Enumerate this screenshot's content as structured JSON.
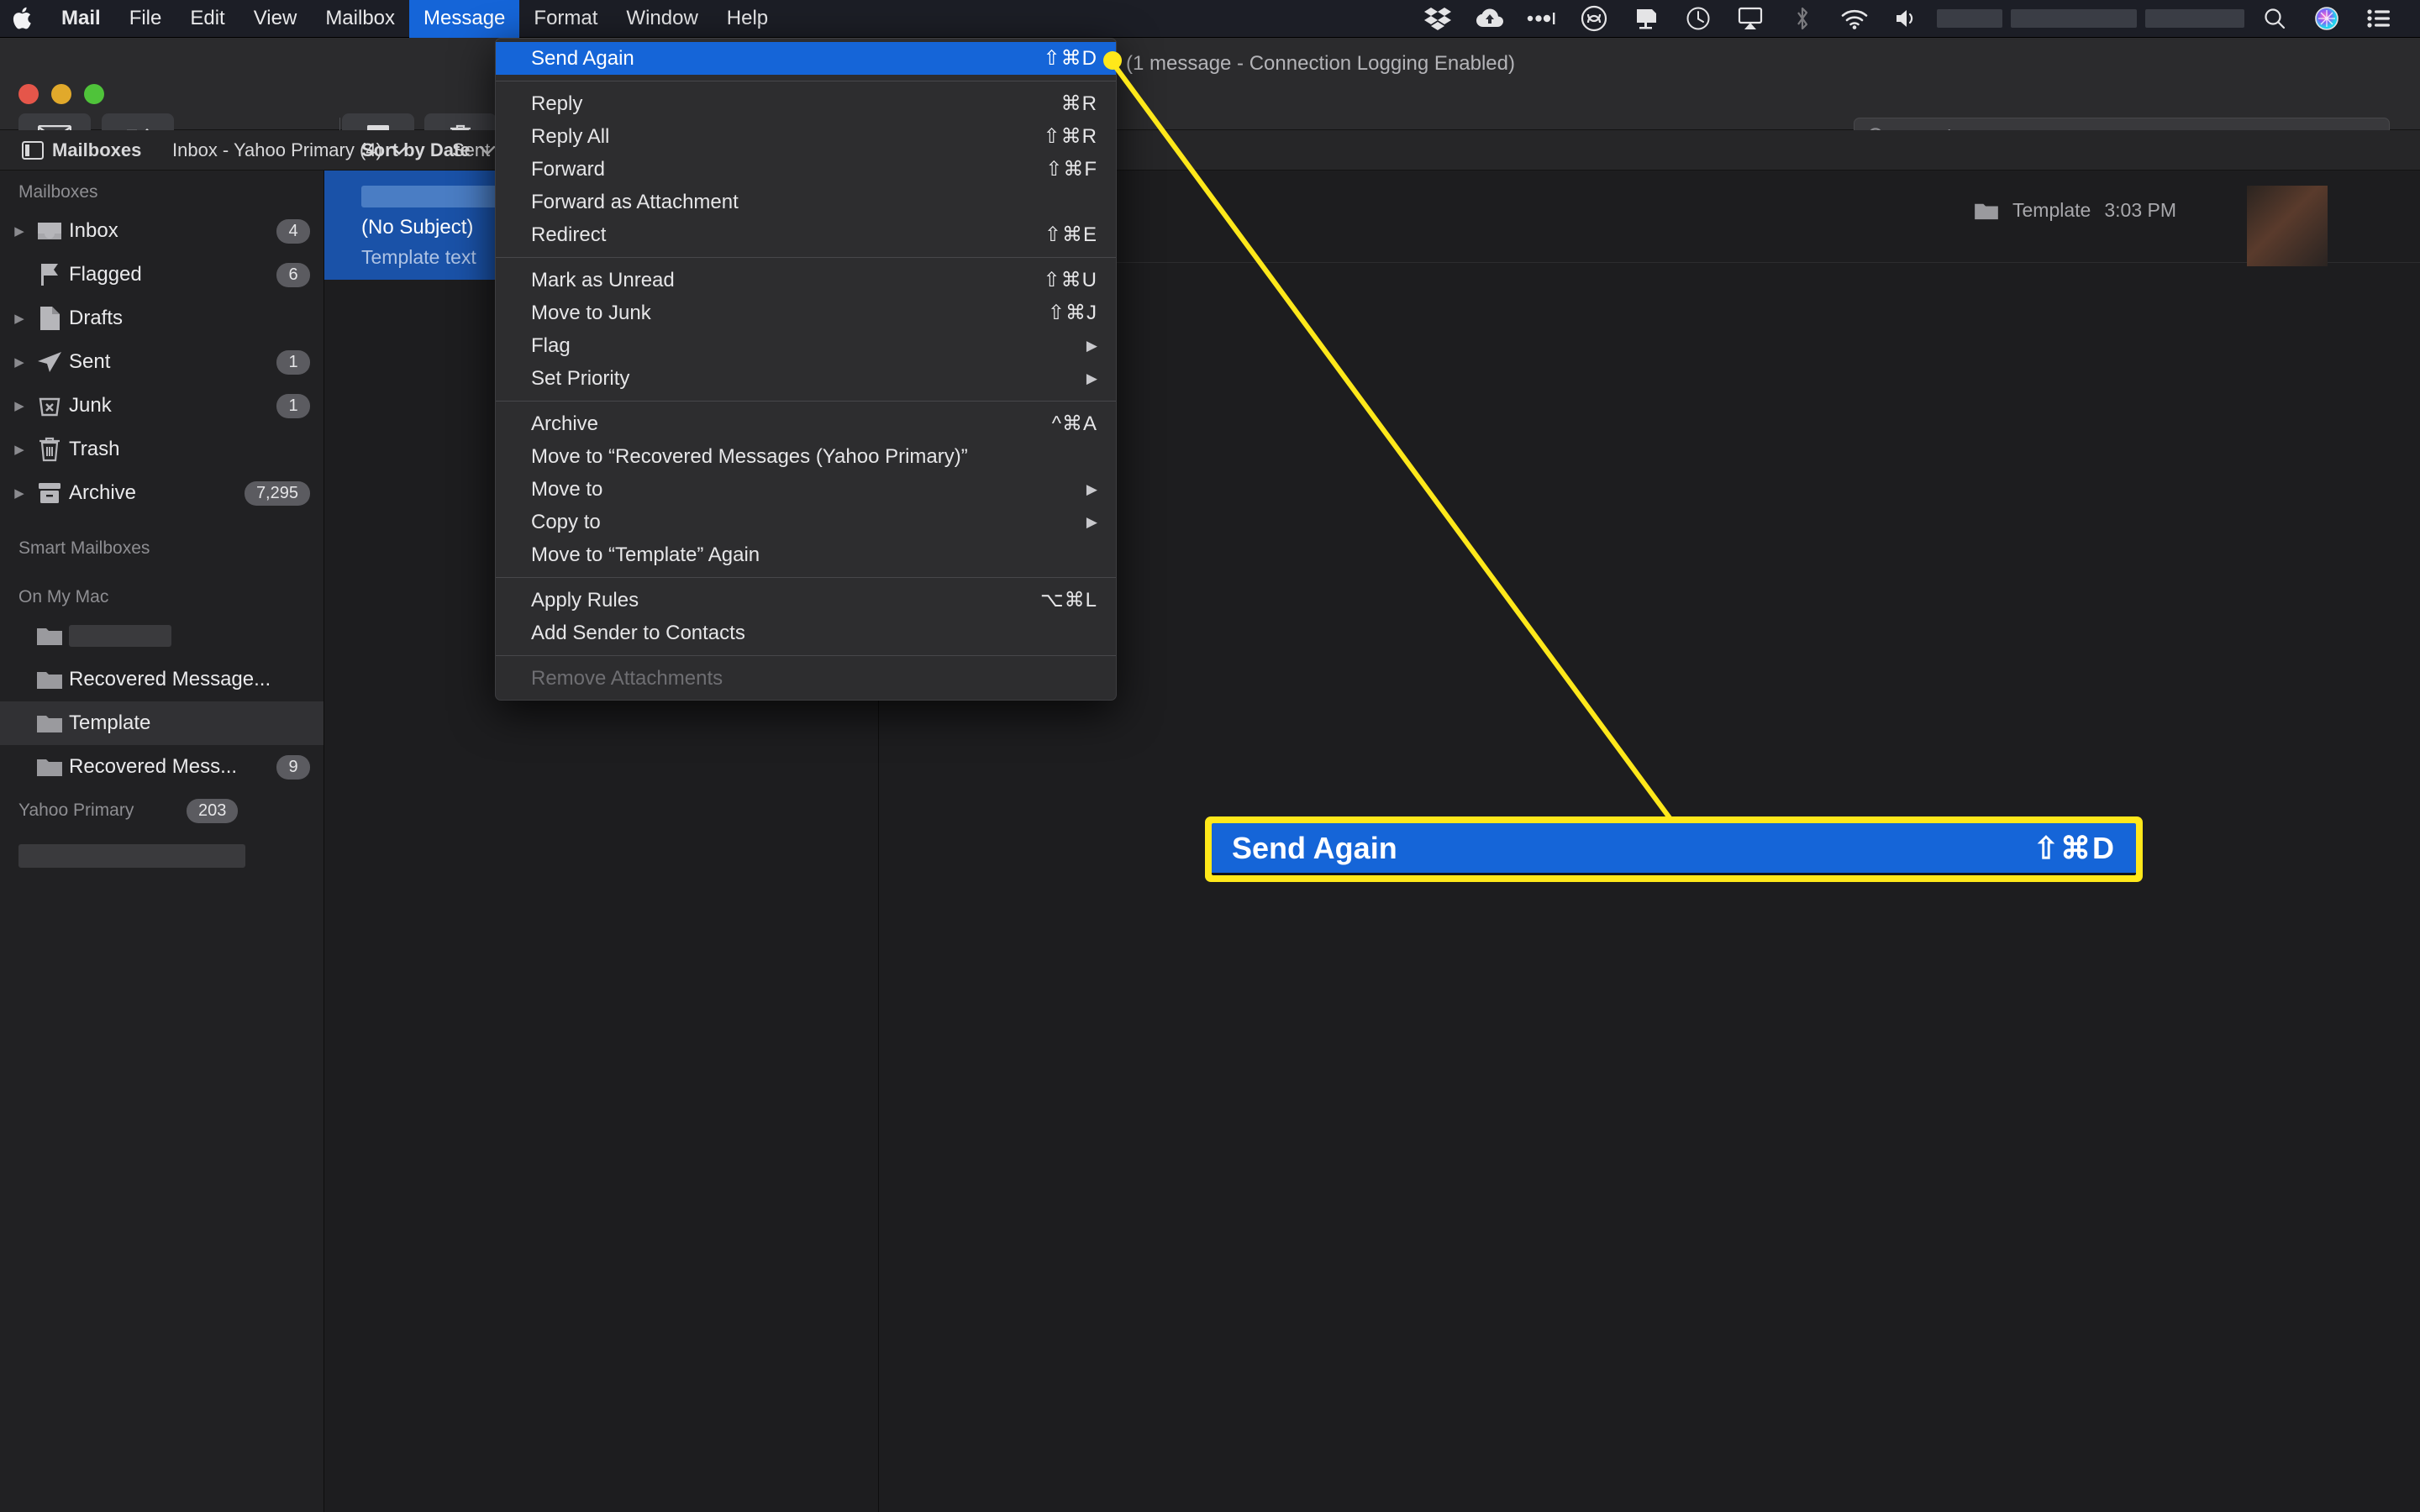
{
  "menubar": {
    "apple_icon": "apple-logo-icon",
    "items": [
      {
        "label": "Mail",
        "bold": true,
        "active": false
      },
      {
        "label": "File",
        "bold": false,
        "active": false
      },
      {
        "label": "Edit",
        "bold": false,
        "active": false
      },
      {
        "label": "View",
        "bold": false,
        "active": false
      },
      {
        "label": "Mailbox",
        "bold": false,
        "active": false
      },
      {
        "label": "Message",
        "bold": false,
        "active": true
      },
      {
        "label": "Format",
        "bold": false,
        "active": false
      },
      {
        "label": "Window",
        "bold": false,
        "active": false
      },
      {
        "label": "Help",
        "bold": false,
        "active": false
      }
    ],
    "status_icons": [
      "dropbox-icon",
      "cloud-upload-icon",
      "dots-icon",
      "creative-cloud-icon",
      "display-icon",
      "time-machine-icon",
      "airplay-icon",
      "bluetooth-icon",
      "wifi-icon",
      "volume-icon"
    ],
    "right_icons": [
      "spotlight-search-icon",
      "siri-icon",
      "control-center-icon"
    ]
  },
  "window": {
    "title_status": "(1 message - Connection Logging Enabled)",
    "toolbar": {
      "mail_button": "mail-icon",
      "compose_button": "compose-icon",
      "archive_button": "archive-icon",
      "delete_button": "trash-icon"
    },
    "search": {
      "placeholder": "Search",
      "value": ""
    },
    "subbar": {
      "mailboxes_label": "Mailboxes",
      "inbox_label": "Inbox - Yahoo Primary (4)",
      "sent_label": "Sent",
      "sort_label": "Sort by Date"
    }
  },
  "sidebar": {
    "section_mailboxes": "Mailboxes",
    "section_smart": "Smart Mailboxes",
    "section_onmymac": "On My Mac",
    "mailboxes": [
      {
        "label": "Inbox",
        "icon": "inbox-icon",
        "badge": "4",
        "disclosure": true
      },
      {
        "label": "Flagged",
        "icon": "flag-icon",
        "badge": "6",
        "disclosure": false
      },
      {
        "label": "Drafts",
        "icon": "drafts-icon",
        "badge": "",
        "disclosure": true
      },
      {
        "label": "Sent",
        "icon": "sent-icon",
        "badge": "1",
        "disclosure": true
      },
      {
        "label": "Junk",
        "icon": "junk-icon",
        "badge": "1",
        "disclosure": true
      },
      {
        "label": "Trash",
        "icon": "trash-icon",
        "badge": "",
        "disclosure": true
      },
      {
        "label": "Archive",
        "icon": "archive-icon",
        "badge": "7,295",
        "disclosure": true
      }
    ],
    "local_folders": [
      {
        "label": "",
        "icon": "folder-icon",
        "badge": "",
        "redacted": true,
        "selected": false
      },
      {
        "label": "Recovered Message...",
        "icon": "folder-icon",
        "badge": "",
        "redacted": false,
        "selected": false
      },
      {
        "label": "Template",
        "icon": "folder-icon",
        "badge": "",
        "redacted": false,
        "selected": true
      },
      {
        "label": "Recovered Mess...",
        "icon": "folder-icon",
        "badge": "9",
        "redacted": false,
        "selected": false
      }
    ],
    "account": {
      "label": "Yahoo Primary",
      "badge": "203"
    }
  },
  "message_list": {
    "sort_label": "Sort by Date",
    "items": [
      {
        "sender_redacted": true,
        "subject": "(No Subject)",
        "preview": "Template text",
        "selected": true
      }
    ]
  },
  "reading_pane": {
    "folder": "Template",
    "time": "3:03 PM"
  },
  "menu": {
    "title": "Message",
    "groups": [
      [
        {
          "label": "Send Again",
          "shortcut": "⇧⌘D",
          "highlighted": true,
          "submenu": false,
          "disabled": false
        }
      ],
      [
        {
          "label": "Reply",
          "shortcut": "⌘R",
          "highlighted": false,
          "submenu": false,
          "disabled": false
        },
        {
          "label": "Reply All",
          "shortcut": "⇧⌘R",
          "highlighted": false,
          "submenu": false,
          "disabled": false
        },
        {
          "label": "Forward",
          "shortcut": "⇧⌘F",
          "highlighted": false,
          "submenu": false,
          "disabled": false
        },
        {
          "label": "Forward as Attachment",
          "shortcut": "",
          "highlighted": false,
          "submenu": false,
          "disabled": false
        },
        {
          "label": "Redirect",
          "shortcut": "⇧⌘E",
          "highlighted": false,
          "submenu": false,
          "disabled": false
        }
      ],
      [
        {
          "label": "Mark as Unread",
          "shortcut": "⇧⌘U",
          "highlighted": false,
          "submenu": false,
          "disabled": false
        },
        {
          "label": "Move to Junk",
          "shortcut": "⇧⌘J",
          "highlighted": false,
          "submenu": false,
          "disabled": false
        },
        {
          "label": "Flag",
          "shortcut": "",
          "highlighted": false,
          "submenu": true,
          "disabled": false
        },
        {
          "label": "Set Priority",
          "shortcut": "",
          "highlighted": false,
          "submenu": true,
          "disabled": false
        }
      ],
      [
        {
          "label": "Archive",
          "shortcut": "^⌘A",
          "highlighted": false,
          "submenu": false,
          "disabled": false
        },
        {
          "label": "Move to “Recovered Messages (Yahoo Primary)”",
          "shortcut": "",
          "highlighted": false,
          "submenu": false,
          "disabled": false
        },
        {
          "label": "Move to",
          "shortcut": "",
          "highlighted": false,
          "submenu": true,
          "disabled": false
        },
        {
          "label": "Copy to",
          "shortcut": "",
          "highlighted": false,
          "submenu": true,
          "disabled": false
        },
        {
          "label": "Move to “Template” Again",
          "shortcut": "",
          "highlighted": false,
          "submenu": false,
          "disabled": false
        }
      ],
      [
        {
          "label": "Apply Rules",
          "shortcut": "⌥⌘L",
          "highlighted": false,
          "submenu": false,
          "disabled": false
        },
        {
          "label": "Add Sender to Contacts",
          "shortcut": "",
          "highlighted": false,
          "submenu": false,
          "disabled": false
        }
      ],
      [
        {
          "label": "Remove Attachments",
          "shortcut": "",
          "highlighted": false,
          "submenu": false,
          "disabled": true
        }
      ]
    ]
  },
  "callout": {
    "label": "Send Again",
    "shortcut": "⇧⌘D",
    "border_color": "#ffe81a",
    "fill_color": "#1565d8",
    "leader_color": "#ffe81a"
  }
}
